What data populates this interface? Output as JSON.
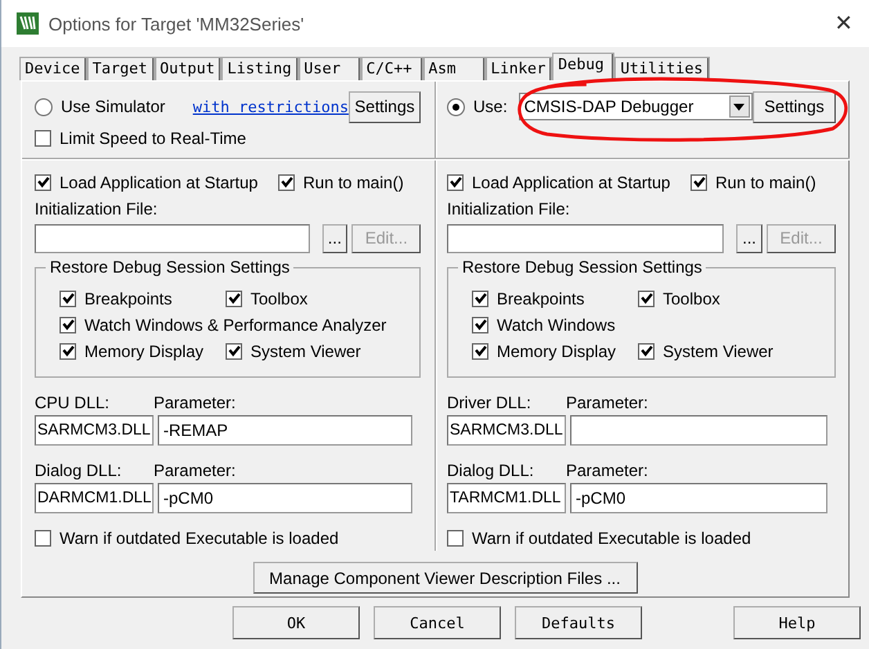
{
  "window": {
    "title": "Options for Target 'MM32Series'",
    "close": "✕"
  },
  "tabs": [
    {
      "label": "Device",
      "selected": false
    },
    {
      "label": "Target",
      "selected": false
    },
    {
      "label": "Output",
      "selected": false
    },
    {
      "label": "Listing",
      "selected": false
    },
    {
      "label": "User",
      "selected": false
    },
    {
      "label": "C/C++",
      "selected": false
    },
    {
      "label": "Asm",
      "selected": false
    },
    {
      "label": "Linker",
      "selected": false
    },
    {
      "label": "Debug",
      "selected": true
    },
    {
      "label": "Utilities",
      "selected": false
    }
  ],
  "columns": [
    {
      "mode": {
        "kind": "simulator",
        "label": "Use Simulator",
        "selected": false,
        "link": "with restrictions",
        "button": "Settings"
      },
      "limit_speed": {
        "label": "Limit Speed to Real-Time",
        "checked": false
      },
      "load_app": {
        "label": "Load Application at Startup",
        "checked": true
      },
      "run_to_main": {
        "label": "Run to main()",
        "checked": true
      },
      "init_file": {
        "label": "Initialization File:",
        "browse": "...",
        "edit": "Edit...",
        "edit_disabled": true
      },
      "restore": {
        "title": "Restore Debug Session Settings",
        "rows": [
          [
            {
              "label": "Breakpoints",
              "checked": true
            },
            {
              "label": "Toolbox",
              "checked": true
            }
          ],
          [
            {
              "label": "Watch Windows & Performance Analyzer",
              "checked": true
            }
          ],
          [
            {
              "label": "Memory Display",
              "checked": true
            },
            {
              "label": "System Viewer",
              "checked": true
            }
          ]
        ]
      },
      "dlls": [
        {
          "label": "CPU DLL:",
          "value": "SARMCM3.DLL",
          "param_label": "Parameter:",
          "param": "-REMAP"
        },
        {
          "label": "Dialog DLL:",
          "value": "DARMCM1.DLL",
          "param_label": "Parameter:",
          "param": "-pCM0"
        }
      ],
      "warn": {
        "label": "Warn if outdated Executable is loaded",
        "checked": false
      }
    },
    {
      "mode": {
        "kind": "target",
        "label": "Use:",
        "selected": true,
        "dropdown": "CMSIS-DAP Debugger",
        "button": "Settings"
      },
      "load_app": {
        "label": "Load Application at Startup",
        "checked": true
      },
      "run_to_main": {
        "label": "Run to main()",
        "checked": true
      },
      "init_file": {
        "label": "Initialization File:",
        "browse": "...",
        "edit": "Edit...",
        "edit_disabled": true
      },
      "restore": {
        "title": "Restore Debug Session Settings",
        "rows": [
          [
            {
              "label": "Breakpoints",
              "checked": true
            },
            {
              "label": "Toolbox",
              "checked": true
            }
          ],
          [
            {
              "label": "Watch Windows",
              "checked": true
            }
          ],
          [
            {
              "label": "Memory Display",
              "checked": true
            },
            {
              "label": "System Viewer",
              "checked": true
            }
          ]
        ]
      },
      "dlls": [
        {
          "label": "Driver DLL:",
          "value": "SARMCM3.DLL",
          "param_label": "Parameter:"
        },
        {
          "label": "Dialog DLL:",
          "value": "TARMCM1.DLL",
          "param_label": "Parameter:",
          "param": "-pCM0"
        }
      ],
      "warn": {
        "label": "Warn if outdated Executable is loaded",
        "checked": false
      }
    }
  ],
  "manage_button": "Manage Component Viewer Description Files ...",
  "buttons": [
    "OK",
    "Cancel",
    "Defaults",
    "Help"
  ]
}
